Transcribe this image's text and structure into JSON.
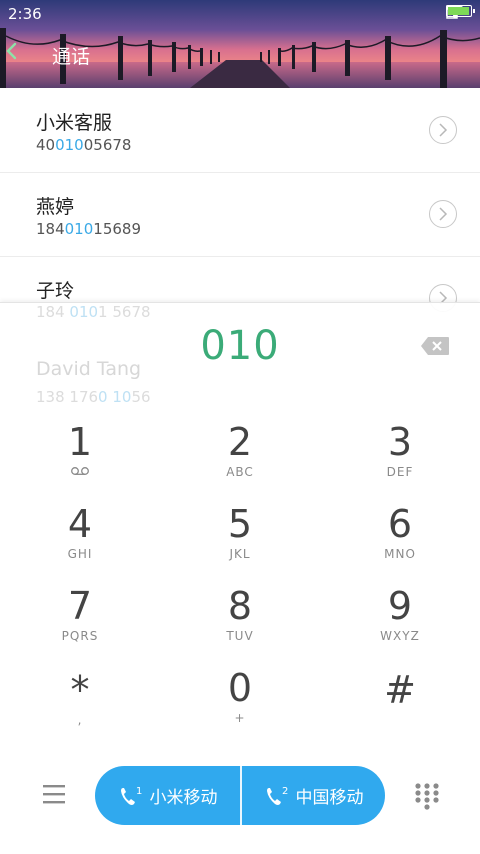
{
  "status_bar": {
    "time": "2:36"
  },
  "header": {
    "title": "通话"
  },
  "contacts": [
    {
      "name": "小米客服",
      "number_pre": "40",
      "number_match": "010",
      "number_post": "05678"
    },
    {
      "name": "燕婷",
      "number_pre": "184",
      "number_match": "010",
      "number_post": "15689"
    },
    {
      "name": "子玲",
      "number_pre": "",
      "number_match": "",
      "number_post": ""
    }
  ],
  "dialpad": {
    "entered": "010",
    "ghost_contacts": [
      {
        "name": "",
        "number_pre": "184 ",
        "number_match": "010",
        "number_post": "1 5678"
      },
      {
        "name": "David Tang",
        "number_pre": "138 176",
        "number_match": "0 10",
        "number_post": "56"
      }
    ],
    "keys": [
      {
        "digit": "1",
        "letters": ""
      },
      {
        "digit": "2",
        "letters": "ABC"
      },
      {
        "digit": "3",
        "letters": "DEF"
      },
      {
        "digit": "4",
        "letters": "GHI"
      },
      {
        "digit": "5",
        "letters": "JKL"
      },
      {
        "digit": "6",
        "letters": "MNO"
      },
      {
        "digit": "7",
        "letters": "PQRS"
      },
      {
        "digit": "8",
        "letters": "TUV"
      },
      {
        "digit": "9",
        "letters": "WXYZ"
      },
      {
        "digit": "*",
        "letters": ","
      },
      {
        "digit": "0",
        "letters": "+"
      },
      {
        "digit": "#",
        "letters": ""
      }
    ]
  },
  "call": {
    "sim1_label": "小米移动",
    "sim1_index": "1",
    "sim2_label": "中国移动",
    "sim2_index": "2"
  },
  "colors": {
    "accent_green": "#3bab78",
    "call_blue": "#30a9ee",
    "match_blue": "#3aa9e6"
  }
}
